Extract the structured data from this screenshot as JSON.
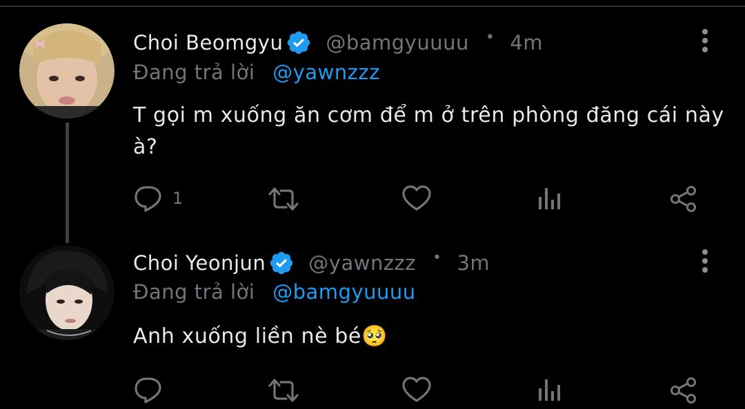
{
  "tweets": [
    {
      "display_name": "Choi Beomgyu",
      "handle": "@bamgyuuuu",
      "time": "4m",
      "reply_prefix": "Đang trả lời",
      "reply_to": "@yawnzzz",
      "text": "T gọi m xuống ăn cơm để m ở trên phòng đăng cái này à?",
      "reply_count": "1",
      "avatar": "beomgyu-avatar"
    },
    {
      "display_name": "Choi Yeonjun",
      "handle": "@yawnzzz",
      "time": "3m",
      "reply_prefix": "Đang trả lời",
      "reply_to": "@bamgyuuuu",
      "text": "Anh xuống liền nè bé🥺",
      "reply_count": "",
      "avatar": "yeonjun-avatar"
    }
  ],
  "icons": {
    "verified": "verified-badge-icon",
    "more": "more-vertical-icon",
    "reply": "reply-bubble-icon",
    "retweet": "retweet-icon",
    "like": "heart-icon",
    "views": "analytics-icon",
    "share": "share-icon"
  },
  "colors": {
    "background": "#000000",
    "text": "#e7e9ea",
    "secondary": "#71767b",
    "accent": "#1d9bf0"
  }
}
